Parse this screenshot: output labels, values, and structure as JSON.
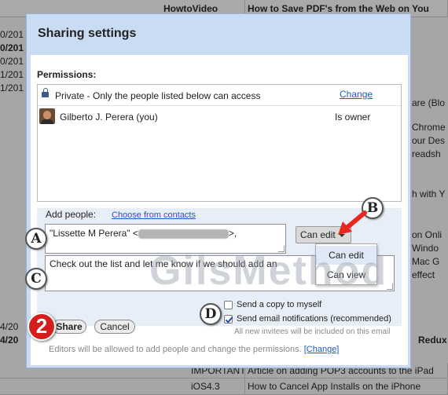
{
  "background": {
    "header_cells": [
      "HowtoVideo",
      "How to Save PDF's from the Web on You"
    ],
    "left_dates": [
      "0/201",
      "0/201",
      "0/201",
      "1/201",
      "1/201",
      "4/20",
      "4/20"
    ],
    "right_fragments": [
      "are (Blo",
      "Chrome",
      "our Des",
      "readsh",
      "h with Y",
      "on Onli",
      "Windo",
      "Mac G",
      "effect",
      "Redux"
    ],
    "bottom_rows": [
      {
        "col1": "IMPORTANT",
        "col2": "Article on adding POP3 accounts to the iPad"
      },
      {
        "col1": "iOS4.3",
        "col2": "How to Cancel App Installs on the iPhone"
      }
    ]
  },
  "dialog": {
    "title": "Sharing settings",
    "permissions_label": "Permissions:",
    "private_text": "Private - Only the people listed below can access",
    "change_link": "Change",
    "owner_name": "Gilberto J. Perera (you)",
    "owner_role": "Is owner",
    "add_people_label": "Add people:",
    "choose_contacts_link": "Choose from contacts",
    "to_prefix": "\"Lissette M Perera\" <",
    "to_suffix": ">,",
    "message_text": "Check out the list and let me know if we should add an",
    "role_button": "Can edit",
    "role_menu": [
      "Can edit",
      "Can view"
    ],
    "send_copy_label": "Send a copy to myself",
    "send_copy_checked": false,
    "send_notifications_label": "Send email notifications (recommended)",
    "send_notifications_checked": true,
    "invitees_note": "All new invitees will be included on this email",
    "share_button": "Share",
    "cancel_button": "Cancel",
    "editors_note": "Editors will be allowed to add people and change the permissions.",
    "editors_change_link": "[Change]"
  },
  "callouts": {
    "a": "A",
    "b": "B",
    "c": "C",
    "d": "D",
    "step": "2"
  },
  "watermark": "GilsMethod",
  "colors": {
    "dialog_frame": "#c9dcf4",
    "add_area": "#e8eef7",
    "link": "#1e5bbf",
    "arrow": "#e8281d",
    "step_badge": "#d41d1d"
  }
}
